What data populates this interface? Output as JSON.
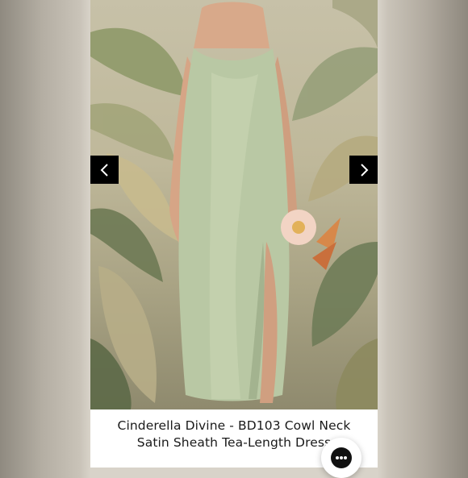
{
  "product": {
    "title_line_1": "Cinderella Divine - BD103 Cowl Neck",
    "title_line_2": "Satin Sheath Tea-Length Dress"
  },
  "image": {
    "dress_color": "#b9c8a4",
    "background_color": "#c2bca2"
  },
  "carousel": {
    "prev_icon": "chevron-left-icon",
    "next_icon": "chevron-right-icon"
  },
  "chat": {
    "icon": "chat-dots-icon"
  }
}
